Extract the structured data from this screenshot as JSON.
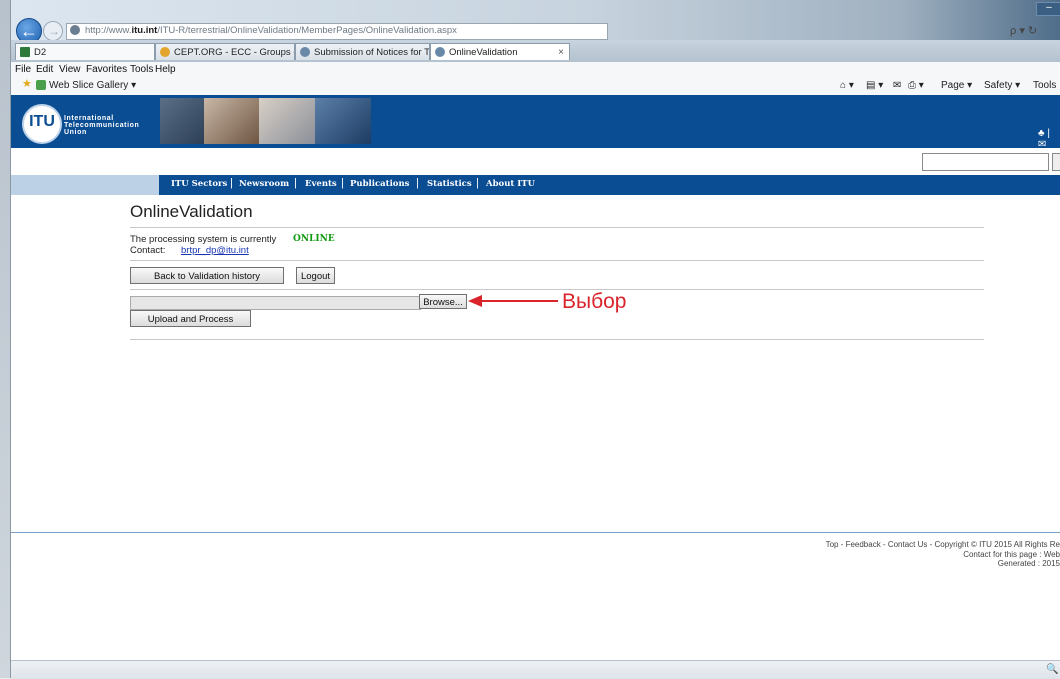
{
  "browser": {
    "address": {
      "prefix": "http://www.",
      "domain": "itu.int",
      "path": "/ITU-R/terrestrial/OnlineValidation/MemberPages/OnlineValidation.aspx"
    },
    "search_ctrl": "ρ ▾ ↻",
    "tabs": [
      {
        "label": "D2"
      },
      {
        "label": "CEPT.ORG - ECC - Groups - EC..."
      },
      {
        "label": "Submission of Notices for Terr..."
      },
      {
        "label": "OnlineValidation"
      }
    ],
    "tab_close": "×",
    "menu": [
      "File",
      "Edit",
      "View",
      "Favorites",
      "Tools",
      "Help"
    ],
    "favorites": {
      "web_slice": "Web Slice Gallery ▾"
    },
    "tools": [
      "Page ▾",
      "Safety ▾",
      "Tools"
    ]
  },
  "header": {
    "logo_text": "ITU",
    "org_name_lines": [
      "International",
      "Telecommunication",
      "Union"
    ],
    "right_icons": "♣ | ✉"
  },
  "nav": {
    "items": [
      "ITU Sectors",
      "Newsroom",
      "Events",
      "Publications",
      "Statistics",
      "About ITU"
    ]
  },
  "main": {
    "title": "OnlineValidation",
    "status_label": "The processing system is currently",
    "status_value": "ONLINE",
    "contact_label": "Contact:",
    "contact_email": "brtpr_dp@itu.int",
    "back_history_label": "Back to Validation history",
    "logout_label": "Logout",
    "browse_label": "Browse...",
    "upload_label": "Upload and Process"
  },
  "annotation": {
    "label": "Выбор",
    "color": "#d9242b"
  },
  "footer": {
    "line1": "Top - Feedback - Contact Us -  Copyright © ITU 2015 All Rights Re",
    "line2": "Contact for this page : Web",
    "line3": "Generated : 2015"
  },
  "colors": {
    "itu_blue": "#0a4d93",
    "online_green": "#119911",
    "link_blue": "#1a36b4"
  }
}
